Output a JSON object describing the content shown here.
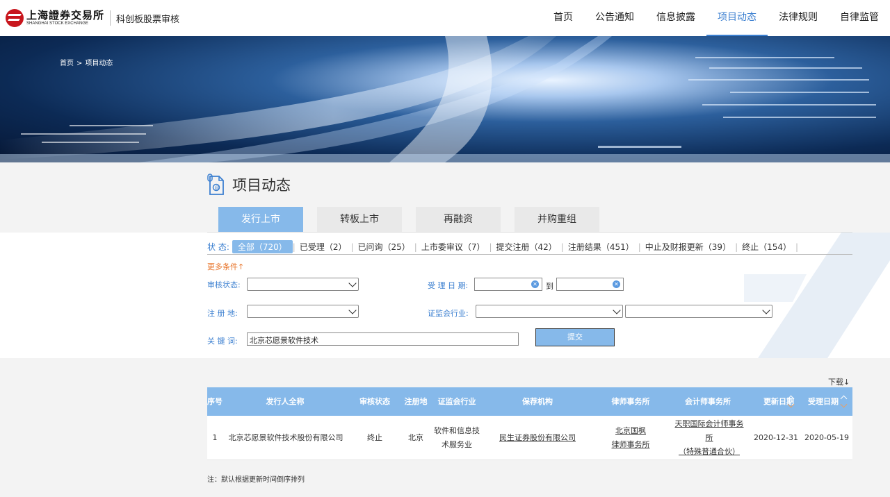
{
  "header": {
    "logo_cn": "上海證券交易所",
    "logo_en": "SHANGHAI STOCK EXCHANGE",
    "logo_sub": "科创板股票审核",
    "nav": [
      "首页",
      "公告通知",
      "信息披露",
      "项目动态",
      "法律规则",
      "自律监管"
    ],
    "nav_active_index": 3
  },
  "breadcrumb": {
    "home": "首页",
    "sep": ">",
    "current": "项目动态"
  },
  "page_title": "项目动态",
  "tabs": [
    "发行上市",
    "转板上市",
    "再融资",
    "并购重组"
  ],
  "tab_active_index": 0,
  "status": {
    "label": "状  态:",
    "items": [
      "全部（720）",
      "已受理（2）",
      "已问询（25）",
      "上市委审议（7）",
      "提交注册（42）",
      "注册结果（451）",
      "中止及财报更新（39）",
      "终止（154）"
    ],
    "active_index": 0
  },
  "filters": {
    "more_label": "更多条件↑",
    "review_status_label": "审核状态:",
    "accept_date_label": "受 理 日 期:",
    "date_to": "到",
    "reg_place_label": "注  册  地:",
    "csrc_industry_label": "证监会行业:",
    "keyword_label": "关  键  词:",
    "keyword_value": "北京芯愿景软件技术",
    "submit_label": "提交"
  },
  "table": {
    "download_label": "下载↓",
    "headers": [
      "序号",
      "发行人全称",
      "审核状态",
      "注册地",
      "证监会行业",
      "保荐机构",
      "律师事务所",
      "会计师事务所",
      "更新日期",
      "受理日期"
    ],
    "rows": [
      {
        "index": "1",
        "issuer": "北京芯愿景软件技术股份有限公司",
        "status": "终止",
        "place": "北京",
        "industry_line1": "软件和信息技",
        "industry_line2": "术服务业",
        "sponsor": "民生证券股份有限公司",
        "law_line1": "北京国枫",
        "law_line2": "律师事务所",
        "acct_line1": "天职国际会计师事务",
        "acct_line2": "所",
        "acct_line3": "（特殊普通合伙）",
        "updated": "2020-12-31",
        "accepted": "2020-05-19"
      }
    ],
    "note": "注：默认根据更新时间倒序排列"
  },
  "colors": {
    "accent": "#3b7fd0",
    "tab_active": "#86b9ea",
    "more": "#e8742a",
    "brand_red": "#c8161d"
  }
}
